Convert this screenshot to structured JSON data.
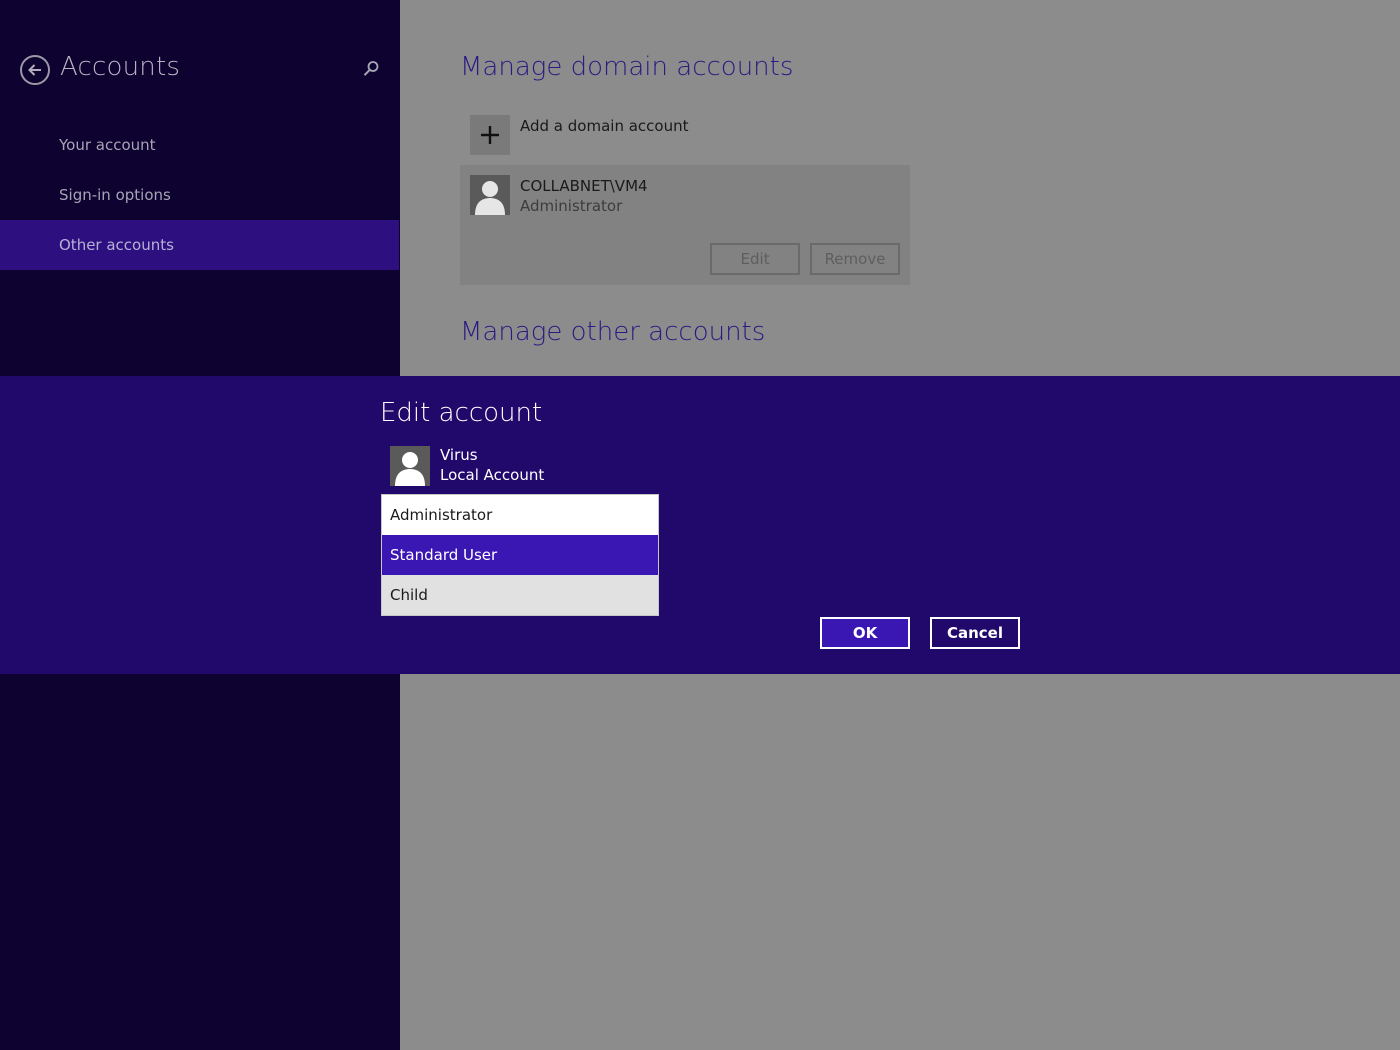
{
  "sidebar": {
    "title": "Accounts",
    "back_icon": "back-arrow-icon",
    "search_icon": "search-icon",
    "items": [
      {
        "label": "Your account",
        "active": false
      },
      {
        "label": "Sign-in options",
        "active": false
      },
      {
        "label": "Other accounts",
        "active": true
      }
    ]
  },
  "main": {
    "domain_section_title": "Manage domain accounts",
    "add_domain_label": "Add a domain account",
    "domain_account": {
      "name": "COLLABNET\\VM4",
      "role": "Administrator",
      "edit_label": "Edit",
      "remove_label": "Remove"
    },
    "other_section_title": "Manage other accounts"
  },
  "dialog": {
    "title": "Edit account",
    "user_name": "Virus",
    "user_type": "Local Account",
    "account_type_options": [
      "Administrator",
      "Standard User",
      "Child"
    ],
    "selected_option": "Standard User",
    "ok_label": "OK",
    "cancel_label": "Cancel"
  },
  "colors": {
    "sidebar_bg": "#0d0230",
    "accent": "#3a16b2",
    "dialog_bg": "#21096c",
    "content_bg": "#8c8c8c"
  }
}
